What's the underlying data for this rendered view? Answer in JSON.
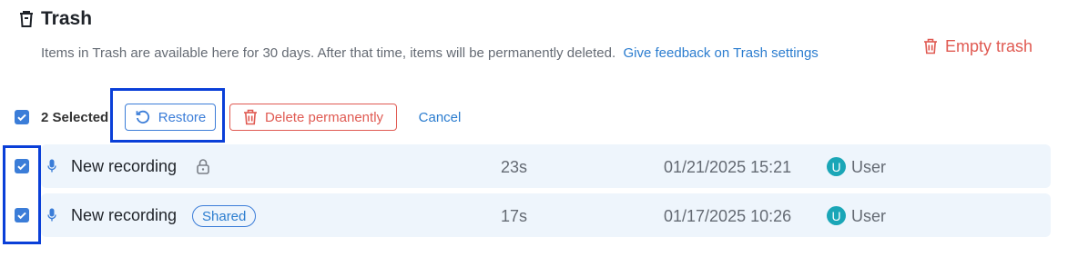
{
  "header": {
    "icon": "trash-icon",
    "title": "Trash",
    "description": "Items in Trash are available here for 30 days. After that time, items will be permanently deleted.",
    "feedback_link": "Give feedback on Trash settings",
    "empty_trash_label": "Empty trash"
  },
  "toolbar": {
    "selected_label": "2 Selected",
    "restore_label": "Restore",
    "delete_label": "Delete permanently",
    "cancel_label": "Cancel"
  },
  "rows": [
    {
      "name": "New recording",
      "status_icon": "lock-icon",
      "duration": "23s",
      "datetime": "01/21/2025 15:21",
      "owner_initial": "U",
      "owner": "User",
      "checked": true
    },
    {
      "name": "New recording",
      "badge": "Shared",
      "duration": "17s",
      "datetime": "01/17/2025 10:26",
      "owner_initial": "U",
      "owner": "User",
      "checked": true
    }
  ],
  "colors": {
    "accent": "#3b7dd8",
    "danger": "#e05a52",
    "row_background": "#eef5fc",
    "avatar": "#1aa6b7",
    "highlight_box": "#0a3fd8"
  }
}
